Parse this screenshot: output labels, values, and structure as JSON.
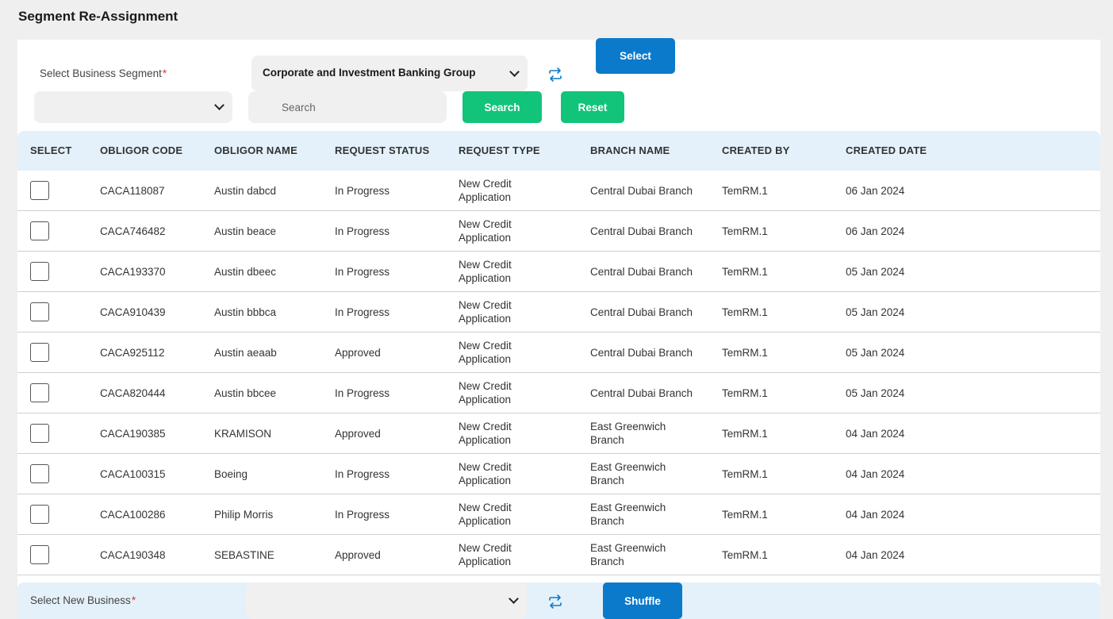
{
  "page": {
    "title": "Segment Re-Assignment"
  },
  "filters": {
    "segment_label": "Select Business Segment",
    "required_mark": "*",
    "segment_value": "Corporate and Investment Banking Group",
    "select_button": "Select",
    "secondary_select_value": "",
    "search_placeholder": "Search",
    "search_value": "",
    "search_button": "Search",
    "reset_button": "Reset"
  },
  "table": {
    "columns": [
      "SELECT",
      "OBLIGOR CODE",
      "OBLIGOR NAME",
      "REQUEST STATUS",
      "REQUEST TYPE",
      "BRANCH NAME",
      "CREATED BY",
      "CREATED DATE"
    ],
    "rows": [
      {
        "code": "CACA118087",
        "name": "Austin dabcd",
        "status": "In Progress",
        "type1": "New Credit",
        "type2": "Application",
        "branch1": "Central Dubai Branch",
        "branch2": "",
        "created_by": "TemRM.1",
        "created_date": "06 Jan 2024"
      },
      {
        "code": "CACA746482",
        "name": "Austin beace",
        "status": "In Progress",
        "type1": "New Credit",
        "type2": "Application",
        "branch1": "Central Dubai Branch",
        "branch2": "",
        "created_by": "TemRM.1",
        "created_date": "06 Jan 2024"
      },
      {
        "code": "CACA193370",
        "name": "Austin dbeec",
        "status": "In Progress",
        "type1": "New Credit",
        "type2": "Application",
        "branch1": "Central Dubai Branch",
        "branch2": "",
        "created_by": "TemRM.1",
        "created_date": "05 Jan 2024"
      },
      {
        "code": "CACA910439",
        "name": "Austin bbbca",
        "status": "In Progress",
        "type1": "New Credit",
        "type2": "Application",
        "branch1": "Central Dubai Branch",
        "branch2": "",
        "created_by": "TemRM.1",
        "created_date": "05 Jan 2024"
      },
      {
        "code": "CACA925112",
        "name": "Austin aeaab",
        "status": "Approved",
        "type1": "New Credit",
        "type2": "Application",
        "branch1": "Central Dubai Branch",
        "branch2": "",
        "created_by": "TemRM.1",
        "created_date": "05 Jan 2024"
      },
      {
        "code": "CACA820444",
        "name": "Austin bbcee",
        "status": "In Progress",
        "type1": "New Credit",
        "type2": "Application",
        "branch1": "Central Dubai Branch",
        "branch2": "",
        "created_by": "TemRM.1",
        "created_date": "05 Jan 2024"
      },
      {
        "code": "CACA190385",
        "name": "KRAMISON",
        "status": "Approved",
        "type1": "New Credit",
        "type2": "Application",
        "branch1": "East Greenwich",
        "branch2": "Branch",
        "created_by": "TemRM.1",
        "created_date": "04 Jan 2024"
      },
      {
        "code": "CACA100315",
        "name": "Boeing",
        "status": "In Progress",
        "type1": "New Credit",
        "type2": "Application",
        "branch1": "East Greenwich",
        "branch2": "Branch",
        "created_by": "TemRM.1",
        "created_date": "04 Jan 2024"
      },
      {
        "code": "CACA100286",
        "name": "Philip Morris",
        "status": "In Progress",
        "type1": "New Credit",
        "type2": "Application",
        "branch1": "East Greenwich",
        "branch2": "Branch",
        "created_by": "TemRM.1",
        "created_date": "04 Jan 2024"
      },
      {
        "code": "CACA190348",
        "name": "SEBASTINE",
        "status": "Approved",
        "type1": "New Credit",
        "type2": "Application",
        "branch1": "East Greenwich",
        "branch2": "Branch",
        "created_by": "TemRM.1",
        "created_date": "04 Jan 2024"
      }
    ]
  },
  "footer": {
    "new_business_label": "Select New Business",
    "required_mark": "*",
    "new_business_value": "",
    "shuffle_button": "Shuffle"
  },
  "icons": {
    "swap": "swap-arrows-icon",
    "chevron": "chevron-down-icon"
  },
  "colors": {
    "primary_blue": "#0b7acb",
    "green": "#12c47a",
    "header_blue": "#e4f1fa",
    "required_red": "#e03030"
  }
}
